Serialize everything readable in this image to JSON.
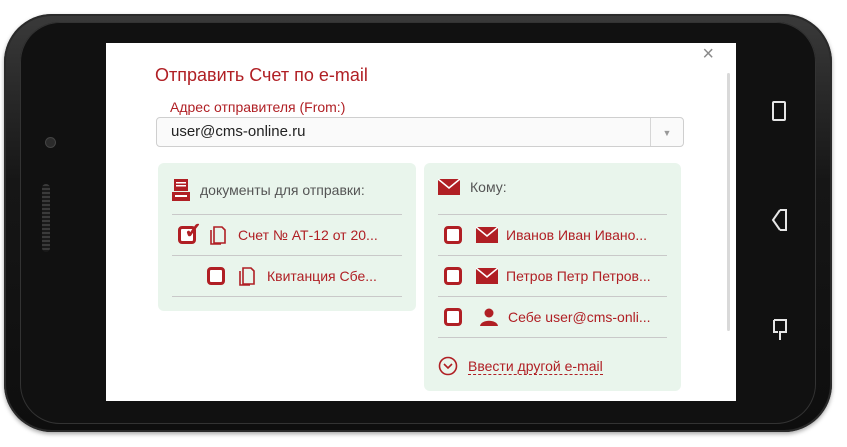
{
  "dialog": {
    "title": "Отправить Счет по e-mail",
    "close_glyph": "×"
  },
  "from": {
    "label": "Адрес отправителя (From:)",
    "value": "user@cms-online.ru",
    "arrow_glyph": "▼"
  },
  "documents": {
    "header": "документы для отправки:",
    "items": [
      {
        "label": "Счет № АТ-12 от 20...",
        "checked": true
      },
      {
        "label": "Квитанция Сбе...",
        "checked": false
      }
    ]
  },
  "recipients": {
    "header": "Кому:",
    "items": [
      {
        "label": "Иванов Иван Ивано...",
        "icon": "envelope-icon",
        "checked": false
      },
      {
        "label": "Петров Петр Петров...",
        "icon": "envelope-icon",
        "checked": false
      },
      {
        "label": "Себе user@cms-onli...",
        "icon": "user-icon",
        "checked": false
      }
    ],
    "add_email_label": "Ввести другой e-mail"
  },
  "colors": {
    "accent": "#b01f24",
    "panel_bg": "#e9f5ec"
  }
}
